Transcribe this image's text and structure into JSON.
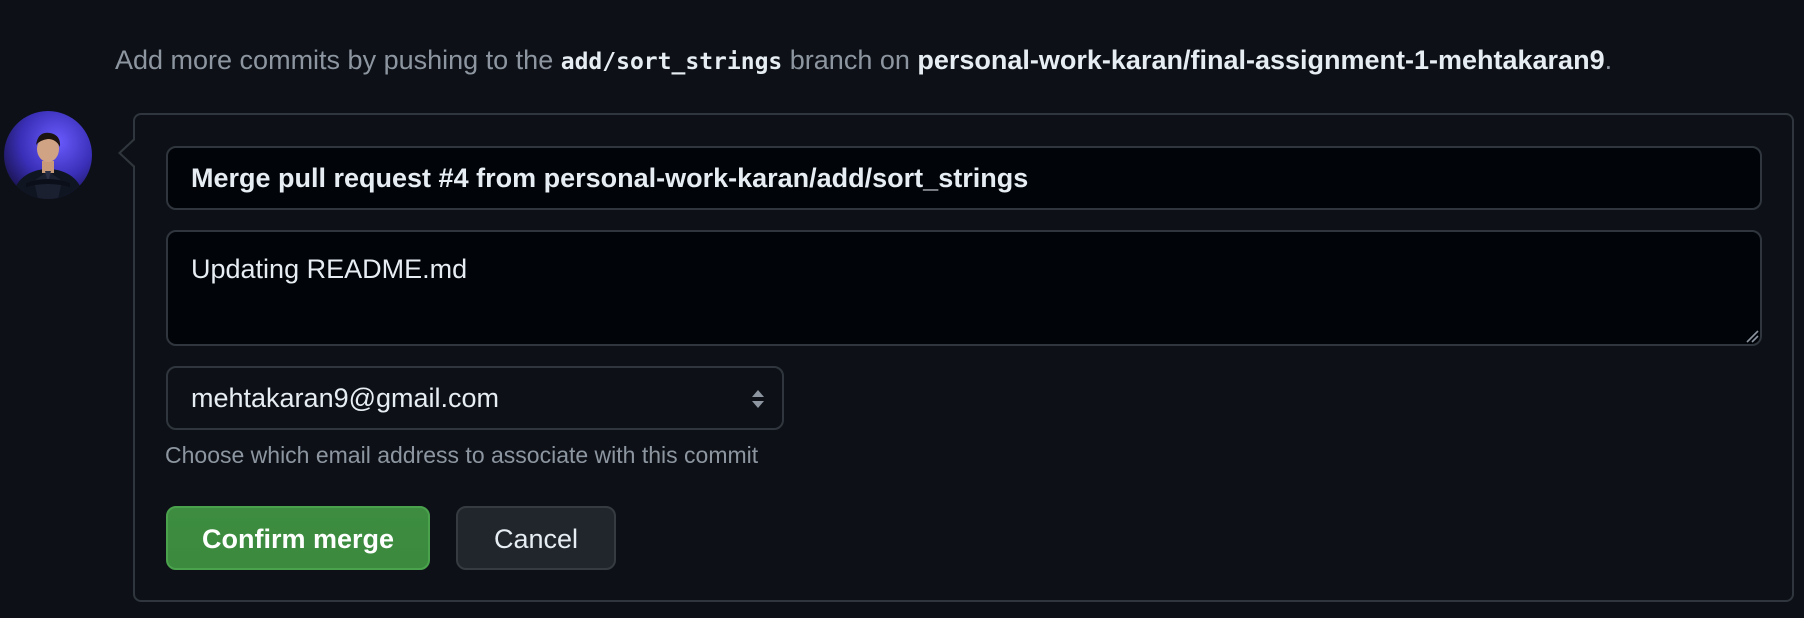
{
  "hint": {
    "prefix": "Add more commits by pushing to the ",
    "branch": "add/sort_strings",
    "middle": " branch on ",
    "repo": "personal-work-karan/final-assignment-1-mehtakaran9",
    "suffix": "."
  },
  "merge_form": {
    "title_value": "Merge pull request #4 from personal-work-karan/add/sort_strings",
    "body_value": "Updating README.md",
    "email": {
      "selected": "mehtakaran9@gmail.com",
      "helper_text": "Choose which email address to associate with this commit"
    },
    "confirm_label": "Confirm merge",
    "cancel_label": "Cancel"
  },
  "colors": {
    "background": "#0d1117",
    "border": "#30363d",
    "confirm_green": "#3b8a3e",
    "muted_text": "#8d96a0"
  },
  "icons": {
    "avatar": "user-avatar",
    "select_arrows": "updown-arrows-icon",
    "resize": "resize-handle-icon"
  }
}
